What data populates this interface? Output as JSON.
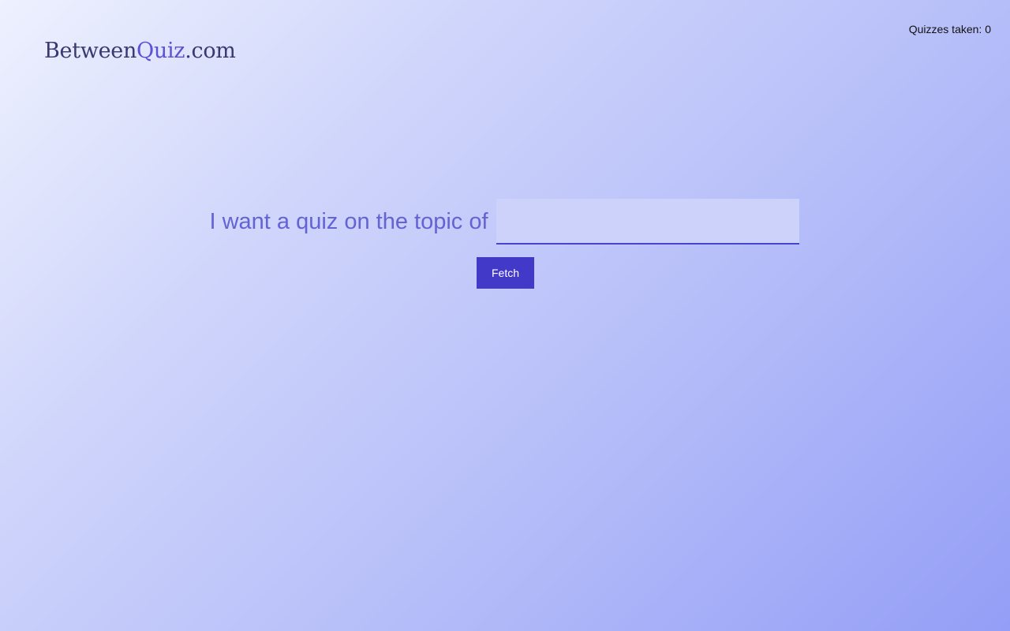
{
  "header": {
    "logo": {
      "part_a": "Between",
      "part_b": "Quiz",
      "part_c": ".com"
    },
    "quiz_count_text": "Quizzes taken: 0"
  },
  "main": {
    "prompt": "I want a quiz on the topic of",
    "topic_input": {
      "value": "",
      "placeholder": ""
    },
    "fetch_label": "Fetch"
  },
  "colors": {
    "accent": "#4339c8",
    "prompt_text": "#6363d4",
    "logo_dark": "#3a3870",
    "logo_accent": "#5a52d6"
  }
}
